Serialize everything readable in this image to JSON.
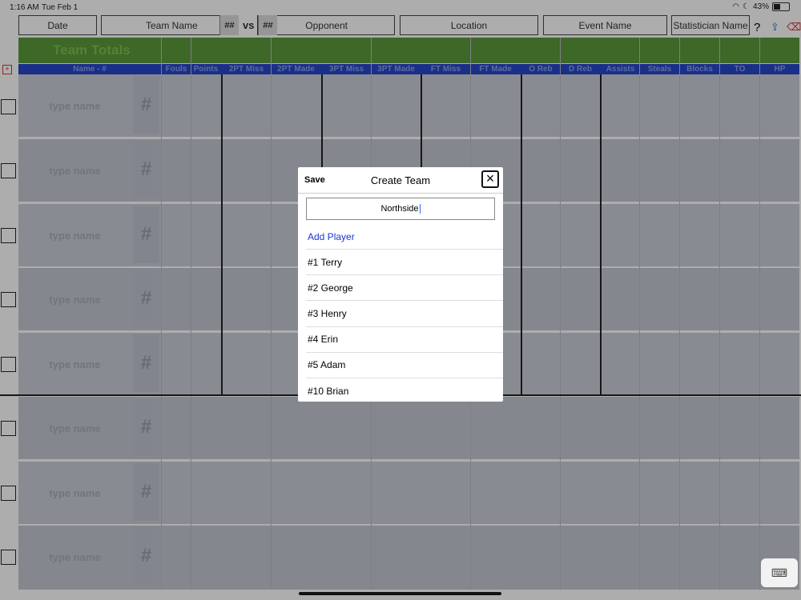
{
  "status": {
    "time": "1:16 AM",
    "date": "Tue Feb 1",
    "battery": "43%"
  },
  "header": {
    "date": "Date",
    "team_name": "Team Name",
    "team_num": "##",
    "vs": "vs",
    "opp_num": "##",
    "opponent": "Opponent",
    "location": "Location",
    "event": "Event Name",
    "statistician": "Statistician Name",
    "help": "?"
  },
  "totals_title": "Team Totals",
  "columns": [
    "Name - #",
    "Fouls",
    "Points",
    "2PT Miss",
    "2PT Made",
    "3PT Miss",
    "3PT Made",
    "FT Miss",
    "FT Made",
    "O Reb",
    "D Reb",
    "Assists",
    "Steals",
    "Blocks",
    "TO",
    "HP"
  ],
  "row_placeholder": "type name",
  "row_hash": "#",
  "modal": {
    "save": "Save",
    "title": "Create Team",
    "team_value": "Northside",
    "add_player": "Add Player",
    "players": [
      "#1 Terry",
      "#2 George",
      "#3 Henry",
      "#4 Erin",
      "#5 Adam",
      "#10 Brian"
    ]
  },
  "colors": {
    "green_bar": "#5a9a3a",
    "blue_bar": "#2746c8",
    "link": "#1a35d6"
  }
}
